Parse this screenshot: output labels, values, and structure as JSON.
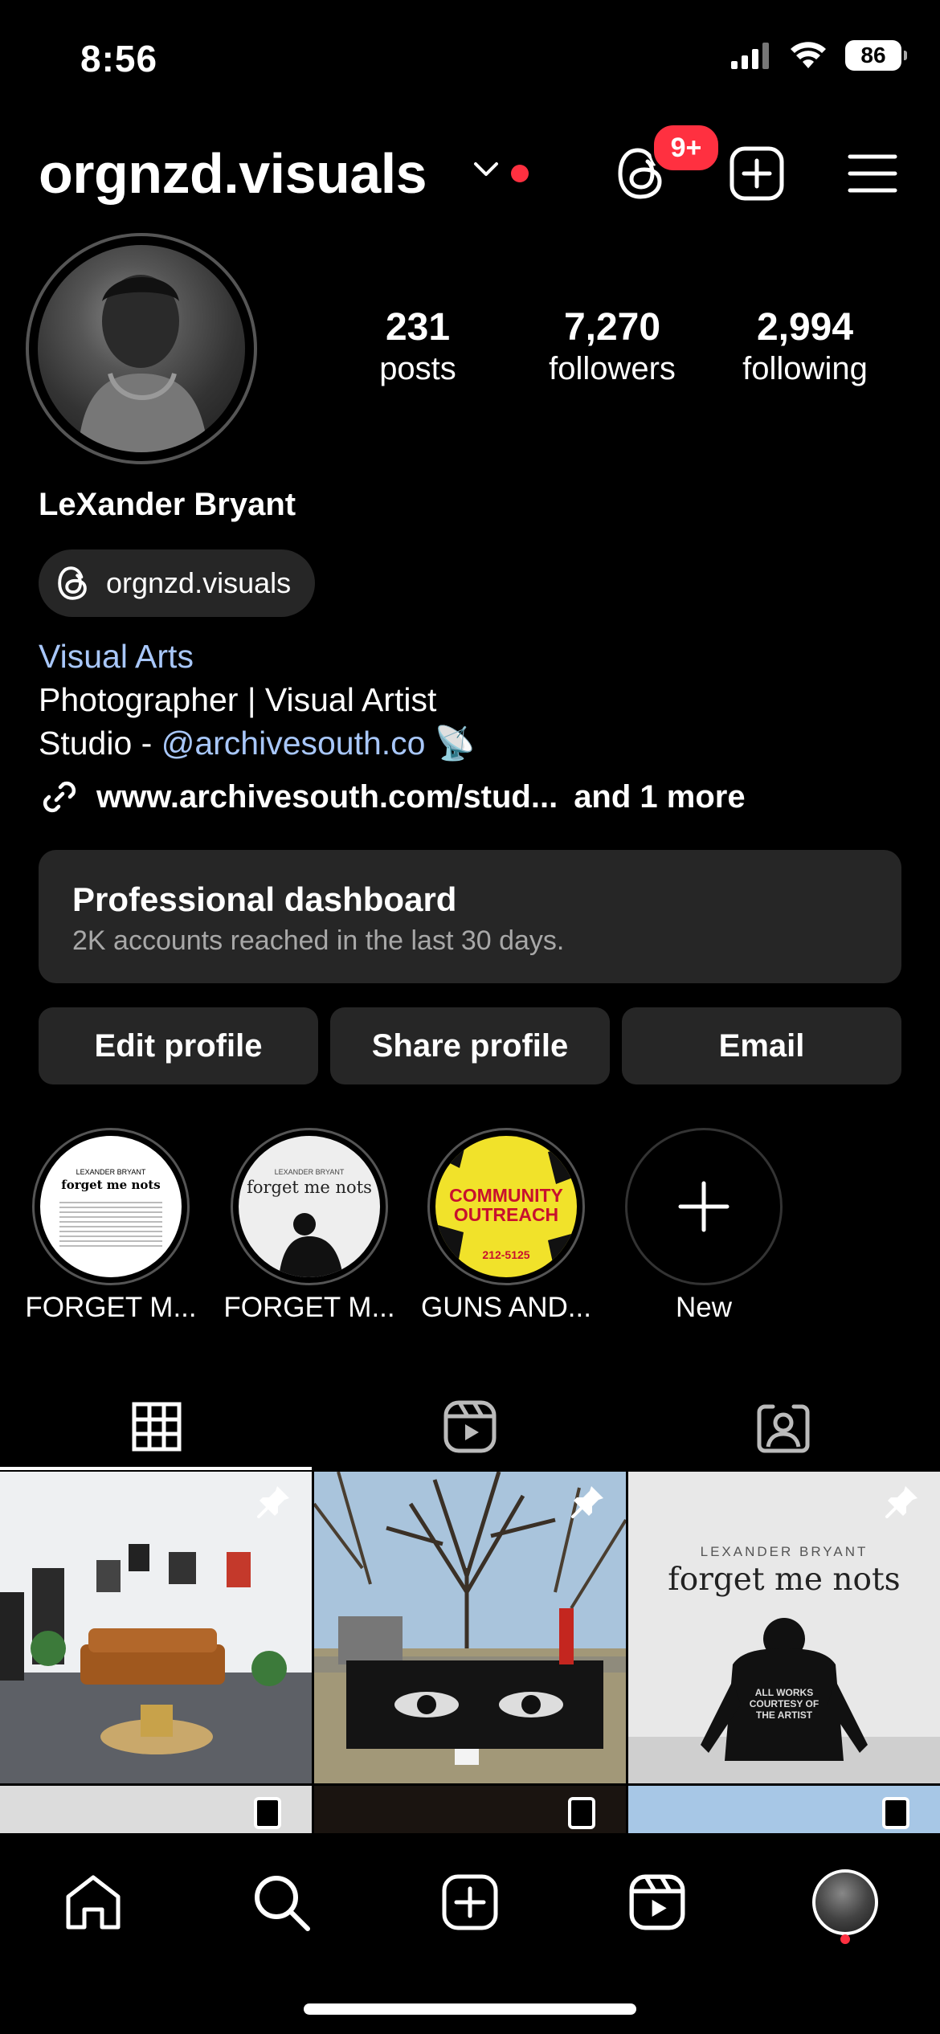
{
  "status_bar": {
    "time": "8:56",
    "battery": "86"
  },
  "header": {
    "username": "orgnzd.visuals",
    "notification_badge": "9+"
  },
  "stats": [
    {
      "value": "231",
      "label": "posts"
    },
    {
      "value": "7,270",
      "label": "followers"
    },
    {
      "value": "2,994",
      "label": "following"
    }
  ],
  "profile": {
    "full_name": "LeXander Bryant",
    "threads_handle": "orgnzd.visuals",
    "category": "Visual Arts",
    "bio_line1": "Photographer | Visual Artist",
    "bio_line2_prefix": "Studio - ",
    "bio_mention": "@archivesouth.co",
    "bio_emoji": "📡",
    "link": "www.archivesouth.com/stud...",
    "link_more": "and 1 more"
  },
  "dashboard": {
    "title": "Professional dashboard",
    "subtitle": "2K accounts reached in the last 30 days."
  },
  "buttons": {
    "edit": "Edit profile",
    "share": "Share profile",
    "email": "Email"
  },
  "highlights": [
    {
      "label": "FORGET M...",
      "cover_title": "forget me nots",
      "cover_kicker": "LEXANDER BRYANT"
    },
    {
      "label": "FORGET M...",
      "cover_title": "forget me nots",
      "cover_kicker": "LEXANDER BRYANT"
    },
    {
      "label": "GUNS AND...",
      "cover_title": "COMMUNITY OUTREACH",
      "cover_kicker": "212-5125"
    },
    {
      "label": "New"
    }
  ],
  "posts": [
    {
      "pinned": true,
      "caption": ""
    },
    {
      "pinned": true,
      "caption": ""
    },
    {
      "pinned": true,
      "overlay_kicker": "LEXANDER BRYANT",
      "overlay_title": "forget me nots",
      "shirt_text": "ALL WORKS COURTESY OF THE ARTIST"
    }
  ],
  "colors": {
    "accent_red": "#ff3040",
    "link_blue": "#a8c7fa",
    "surface": "#262626"
  }
}
